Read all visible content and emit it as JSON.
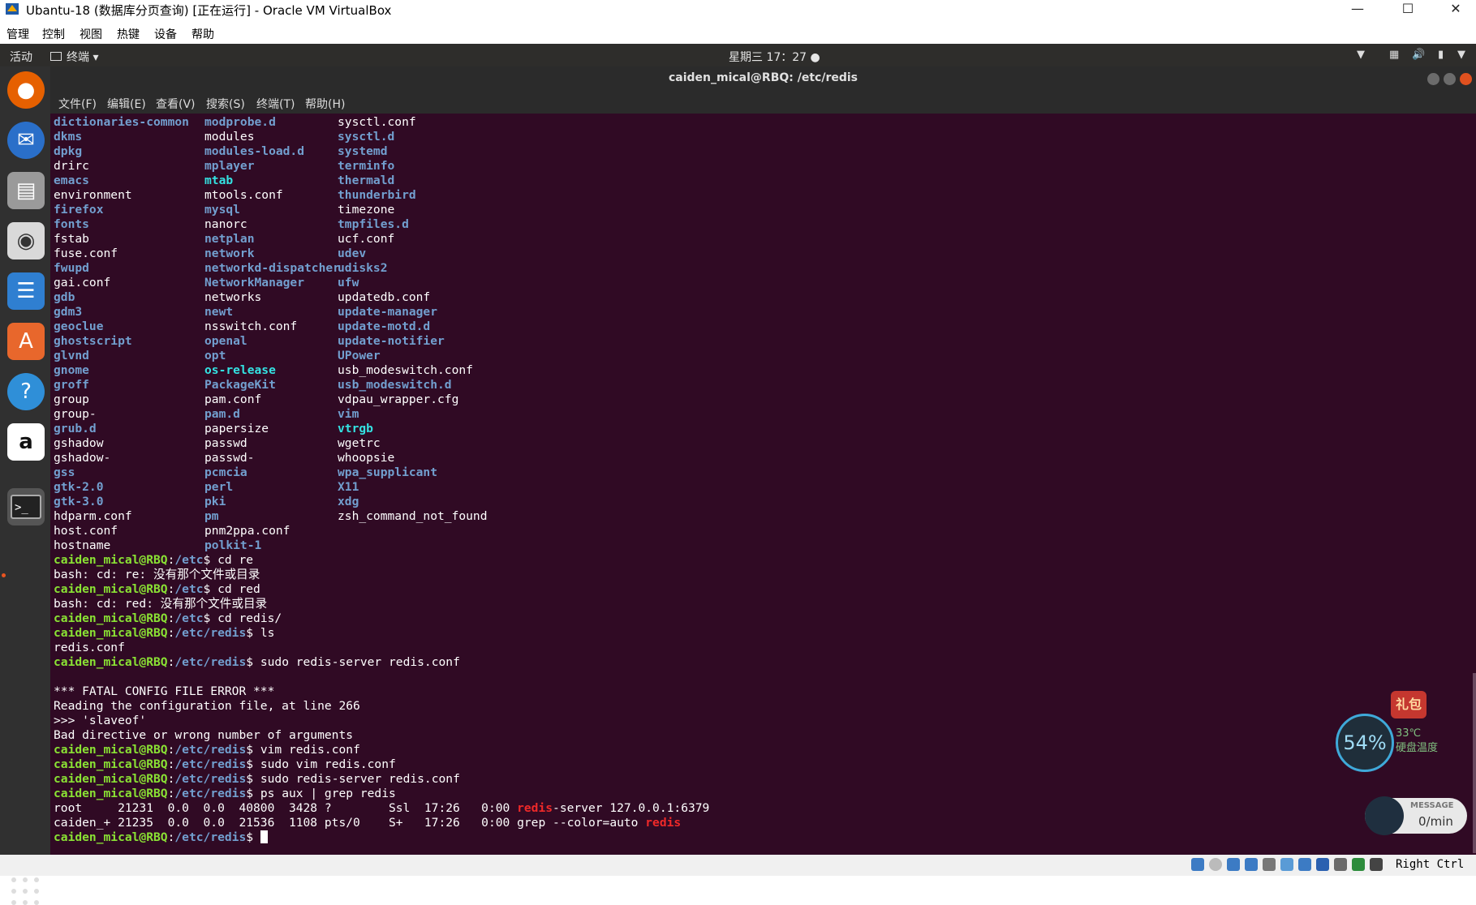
{
  "vbox": {
    "title": "Ubantu-18 (数据库分页查询) [正在运行] - Oracle VM VirtualBox",
    "menu": [
      "管理",
      "控制",
      "视图",
      "热键",
      "设备",
      "帮助"
    ],
    "host_key": "Right Ctrl"
  },
  "gnome": {
    "activities": "活动",
    "app_menu": "终端 ▾",
    "clock": "星期三 17：27"
  },
  "terminal": {
    "title": "caiden_mical@RBQ: /etc/redis",
    "menu": [
      "文件(F)",
      "编辑(E)",
      "查看(V)",
      "搜索(S)",
      "终端(T)",
      "帮助(H)"
    ],
    "listing": [
      [
        "dictionaries-common",
        "modprobe.d",
        "sysctl.conf"
      ],
      [
        "dkms",
        "modules",
        "sysctl.d"
      ],
      [
        "dpkg",
        "modules-load.d",
        "systemd"
      ],
      [
        "drirc",
        "mplayer",
        "terminfo"
      ],
      [
        "emacs",
        "mtab",
        "thermald"
      ],
      [
        "environment",
        "mtools.conf",
        "thunderbird"
      ],
      [
        "firefox",
        "mysql",
        "timezone"
      ],
      [
        "fonts",
        "nanorc",
        "tmpfiles.d"
      ],
      [
        "fstab",
        "netplan",
        "ucf.conf"
      ],
      [
        "fuse.conf",
        "network",
        "udev"
      ],
      [
        "fwupd",
        "networkd-dispatcher",
        "udisks2"
      ],
      [
        "gai.conf",
        "NetworkManager",
        "ufw"
      ],
      [
        "gdb",
        "networks",
        "updatedb.conf"
      ],
      [
        "gdm3",
        "newt",
        "update-manager"
      ],
      [
        "geoclue",
        "nsswitch.conf",
        "update-motd.d"
      ],
      [
        "ghostscript",
        "openal",
        "update-notifier"
      ],
      [
        "glvnd",
        "opt",
        "UPower"
      ],
      [
        "gnome",
        "os-release",
        "usb_modeswitch.conf"
      ],
      [
        "groff",
        "PackageKit",
        "usb_modeswitch.d"
      ],
      [
        "group",
        "pam.conf",
        "vdpau_wrapper.cfg"
      ],
      [
        "group-",
        "pam.d",
        "vim"
      ],
      [
        "grub.d",
        "papersize",
        "vtrgb"
      ],
      [
        "gshadow",
        "passwd",
        "wgetrc"
      ],
      [
        "gshadow-",
        "passwd-",
        "whoopsie"
      ],
      [
        "gss",
        "pcmcia",
        "wpa_supplicant"
      ],
      [
        "gtk-2.0",
        "perl",
        "X11"
      ],
      [
        "gtk-3.0",
        "pki",
        "xdg"
      ],
      [
        "hdparm.conf",
        "pm",
        "zsh_command_not_found"
      ],
      [
        "host.conf",
        "pnm2ppa.conf",
        ""
      ],
      [
        "hostname",
        "polkit-1",
        ""
      ]
    ],
    "prompt_user": "caiden_mical@RBQ",
    "history": [
      {
        "path": "/etc",
        "cmd": "cd re"
      },
      {
        "out": "bash: cd: re: 没有那个文件或目录"
      },
      {
        "path": "/etc",
        "cmd": "cd red"
      },
      {
        "out": "bash: cd: red: 没有那个文件或目录"
      },
      {
        "path": "/etc",
        "cmd": "cd redis/"
      },
      {
        "path": "/etc/redis",
        "cmd": "ls"
      },
      {
        "out": "redis.conf"
      },
      {
        "path": "/etc/redis",
        "cmd": "sudo redis-server redis.conf"
      },
      {
        "out": ""
      },
      {
        "out": "*** FATAL CONFIG FILE ERROR ***"
      },
      {
        "out": "Reading the configuration file, at line 266"
      },
      {
        "out": ">>> 'slaveof'"
      },
      {
        "out": "Bad directive or wrong number of arguments"
      },
      {
        "path": "/etc/redis",
        "cmd": "vim redis.conf"
      },
      {
        "path": "/etc/redis",
        "cmd": "sudo vim redis.conf"
      },
      {
        "path": "/etc/redis",
        "cmd": "sudo redis-server redis.conf"
      },
      {
        "path": "/etc/redis",
        "cmd": "ps aux | grep redis"
      },
      {
        "segs": [
          [
            "root     21231  0.0  0.0  40800  3428 ?        Ssl  17:26   0:00 ",
            "plain"
          ],
          [
            "redis",
            "red"
          ],
          [
            "-server 127.0.0.1:6379",
            "plain"
          ]
        ]
      },
      {
        "segs": [
          [
            "caiden_+ 21235  0.0  0.0  21536  1108 pts/0    S+   17:26   0:00 grep --color=auto ",
            "plain"
          ],
          [
            "redis",
            "red"
          ]
        ]
      },
      {
        "path": "/etc/redis",
        "cmd": "",
        "cursor": true
      }
    ]
  },
  "widgets": {
    "gift_label": "礼包",
    "cpu_percent": "54%",
    "temp": "33℃",
    "temp_label": "硬盘温度",
    "msg_title": "MESSAGE",
    "msg_rate": "0/min"
  },
  "colors": {
    "terminal_bg": "#300a24",
    "dir_blue": "#729fcf",
    "symlink_cyan": "#34e2e2",
    "prompt_green": "#8ae234",
    "grep_red": "#ef2929",
    "ubuntu_orange": "#e95420"
  }
}
